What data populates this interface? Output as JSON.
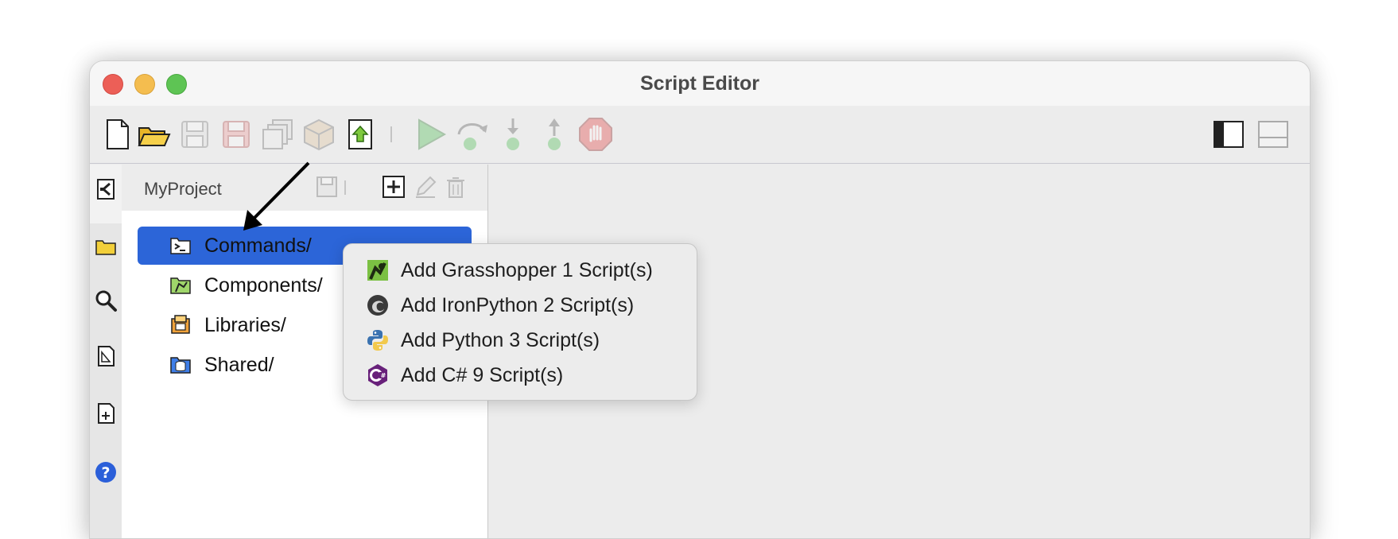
{
  "window": {
    "title": "Script Editor"
  },
  "toolbar": {
    "buttons": [
      {
        "name": "new-file",
        "icon": "new-file-icon",
        "enabled": true
      },
      {
        "name": "open-folder",
        "icon": "open-folder-icon",
        "enabled": true
      },
      {
        "name": "save",
        "icon": "save-icon",
        "enabled": false
      },
      {
        "name": "save-as",
        "icon": "save-as-icon",
        "enabled": false
      },
      {
        "name": "save-all",
        "icon": "save-all-icon",
        "enabled": false
      },
      {
        "name": "package",
        "icon": "package-icon",
        "enabled": false
      },
      {
        "name": "export",
        "icon": "export-icon",
        "enabled": true
      },
      {
        "name": "run",
        "icon": "play-icon",
        "enabled": false
      },
      {
        "name": "step-over",
        "icon": "step-over-icon",
        "enabled": false
      },
      {
        "name": "step-into",
        "icon": "step-into-icon",
        "enabled": false
      },
      {
        "name": "step-out",
        "icon": "step-out-icon",
        "enabled": false
      },
      {
        "name": "stop",
        "icon": "stop-hand-icon",
        "enabled": false
      },
      {
        "name": "toggle-sidebar",
        "icon": "sidebar-toggle-icon",
        "enabled": true
      },
      {
        "name": "toggle-bottom-panel",
        "icon": "bottom-panel-toggle-icon",
        "enabled": false
      }
    ]
  },
  "rail": {
    "icons": [
      "collapse-panel-icon",
      "folder-icon",
      "search-icon",
      "document-icon",
      "new-document-icon",
      "help-icon"
    ]
  },
  "project": {
    "name": "MyProject",
    "tree": [
      {
        "label": "Commands/",
        "icon": "terminal-folder-icon",
        "selected": true
      },
      {
        "label": "Components/",
        "icon": "grasshopper-folder-icon",
        "selected": false
      },
      {
        "label": "Libraries/",
        "icon": "library-folder-icon",
        "selected": false
      },
      {
        "label": "Shared/",
        "icon": "shared-folder-icon",
        "selected": false
      }
    ]
  },
  "context_menu": {
    "items": [
      {
        "label": "Add Grasshopper 1 Script(s)",
        "icon": "grasshopper-icon"
      },
      {
        "label": "Add IronPython 2 Script(s)",
        "icon": "ironpython-icon"
      },
      {
        "label": "Add Python 3 Script(s)",
        "icon": "python-icon"
      },
      {
        "label": "Add C# 9 Script(s)",
        "icon": "csharp-icon"
      }
    ]
  },
  "colors": {
    "selection": "#2c65d8",
    "close": "#ec5f57",
    "minimize": "#f4bd4f",
    "maximize": "#5ec454"
  }
}
